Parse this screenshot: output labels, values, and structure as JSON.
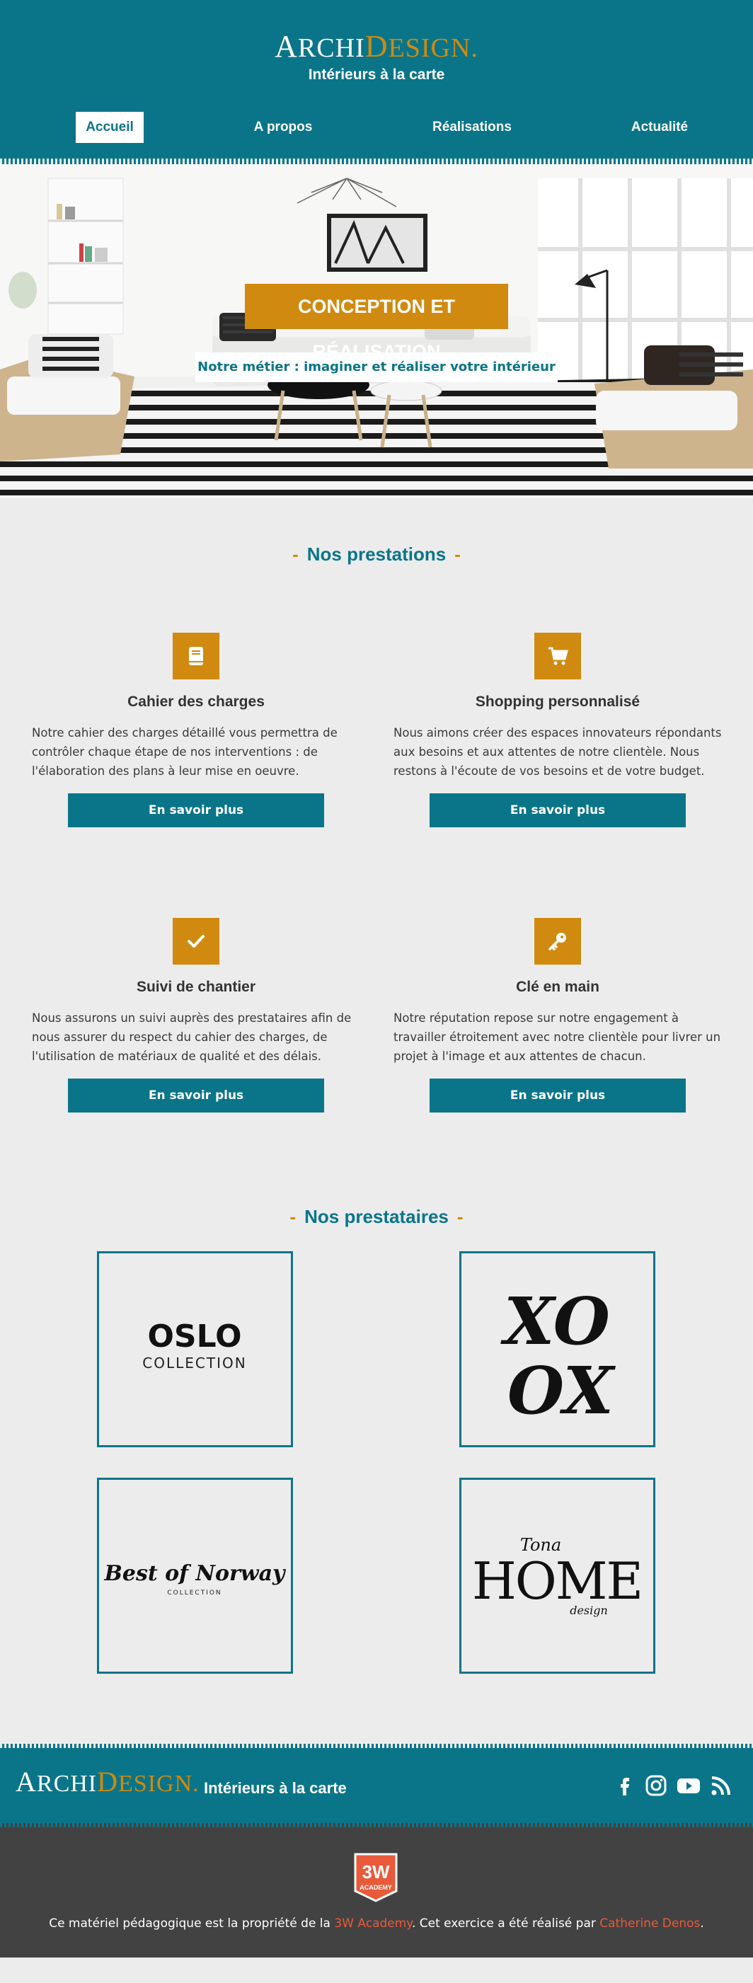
{
  "brand": {
    "name_part1": "Archi",
    "name_part2": "Design.",
    "tagline": "Intérieurs à la carte"
  },
  "nav": [
    {
      "label": "Accueil",
      "active": true
    },
    {
      "label": "A propos",
      "active": false
    },
    {
      "label": "Réalisations",
      "active": false
    },
    {
      "label": "Actualité",
      "active": false
    }
  ],
  "hero": {
    "title": "CONCEPTION ET RÉALISATION",
    "subtitle": "Notre métier : imaginer et réaliser votre intérieur"
  },
  "services": {
    "title": "Nos prestations",
    "items": [
      {
        "icon": "book-icon",
        "title": "Cahier des charges",
        "text": "Notre cahier des charges détaillé vous permettra de contrôler chaque étape de nos interventions : de l'élaboration des plans à leur mise en oeuvre.",
        "button": "En savoir plus"
      },
      {
        "icon": "shopping-cart-icon",
        "title": "Shopping personnalisé",
        "text": "Nous aimons créer des espaces innovateurs répondants aux besoins et aux attentes de notre clientèle. Nous restons à l'écoute de vos besoins et de votre budget.",
        "button": "En savoir plus"
      },
      {
        "icon": "check-icon",
        "title": "Suivi de chantier",
        "text": "Nous assurons un suivi auprès des prestataires afin de nous assurer du respect du cahier des charges, de l'utilisation de matériaux de qualité et des délais.",
        "button": "En savoir plus"
      },
      {
        "icon": "key-icon",
        "title": "Clé en main",
        "text": "Notre réputation repose sur notre engagement à travailler étroitement avec notre clientèle pour livrer un projet à l'image et aux attentes de chacun.",
        "button": "En savoir plus"
      }
    ]
  },
  "partners": {
    "title": "Nos prestataires",
    "logos": [
      {
        "name": "oslo-collection-logo",
        "text1": "OSLO",
        "text2": "COLLECTION"
      },
      {
        "name": "xoox-logo",
        "text1": "XO",
        "text2": "OX"
      },
      {
        "name": "best-of-norway-logo",
        "text1": "Best of Norway",
        "text2": "COLLECTION"
      },
      {
        "name": "home-design-logo",
        "text1": "HOME",
        "text2": "design",
        "text3": "Tona"
      }
    ]
  },
  "footer": {
    "tagline": "Intérieurs à la carte",
    "socials": [
      "facebook-icon",
      "instagram-icon",
      "youtube-icon",
      "rss-icon"
    ]
  },
  "credit": {
    "badge_top": "3W",
    "badge_bottom": "ACADEMY",
    "text_before": "Ce matériel pédagogique est la propriété de la ",
    "academy_link": "3W Academy",
    "text_middle": ". Cet exercice a été réalisé par ",
    "author_link": "Catherine Denos",
    "text_after": "."
  },
  "colors": {
    "primary": "#0a7589",
    "accent": "#d08a0f",
    "dark": "#424242",
    "link": "#e85a3a"
  }
}
